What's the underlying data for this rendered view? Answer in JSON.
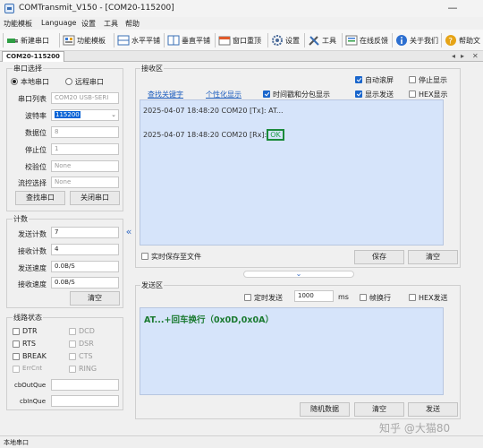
{
  "window": {
    "title": "COMTransmit_V150 - [COM20-115200]",
    "minimize_glyph": "—"
  },
  "menu": [
    "功能模板",
    "Language",
    "设置",
    "工具",
    "帮助"
  ],
  "toolbar": [
    "新建串口",
    "功能模板",
    "水平平铺",
    "垂直平铺",
    "窗口重顶",
    "设置",
    "工具",
    "在线反馈",
    "关于我们",
    "帮助文"
  ],
  "tab": {
    "label": "COM20-115200",
    "left_arrow": "◂",
    "right_arrow": "▸",
    "close": "✕"
  },
  "port": {
    "group_label": "串口选择",
    "local_label": "本地串口",
    "remote_label": "远程串口",
    "rows": [
      {
        "label": "串口列表",
        "value": "COM20  USB-SERI"
      },
      {
        "label": "波特率",
        "value": "115200"
      },
      {
        "label": "数据位",
        "value": "8"
      },
      {
        "label": "停止位",
        "value": "1"
      },
      {
        "label": "校验位",
        "value": "None"
      },
      {
        "label": "流控选择",
        "value": "None"
      }
    ],
    "find_button": "查找串口",
    "close_button": "关闭串口"
  },
  "count": {
    "group_label": "计数",
    "rows": [
      {
        "label": "发送计数",
        "value": "7"
      },
      {
        "label": "接收计数",
        "value": "4"
      },
      {
        "label": "发送速度",
        "value": "0.0B/S"
      },
      {
        "label": "接收速度",
        "value": "0.0B/S"
      }
    ],
    "clear_button": "清空"
  },
  "line": {
    "group_label": "线路状态",
    "checks": [
      {
        "left": "DTR",
        "right": "DCD"
      },
      {
        "left": "RTS",
        "right": "DSR"
      },
      {
        "left": "BREAK",
        "right": "CTS"
      },
      {
        "left": "ErrCnt",
        "right": "RING"
      }
    ],
    "cb_out_label": "cbOutQue",
    "cb_in_label": "cbInQue"
  },
  "receive": {
    "group_label": "接收区",
    "find_keyword": "查找关键字",
    "personalize": "个性化显示",
    "timestamp_label": "时间戳和分包显示",
    "auto_scroll": "自动滚屏",
    "stop_display": "停止显示",
    "show_send": "显示发送",
    "hex_display": "HEX显示",
    "line1": "2025-04-07 18:48:20 COM20 [Tx]: AT...",
    "line2_prefix": "2025-04-07 18:48:20 COM20 [Rx]:",
    "line2_ok": "OK",
    "save_realtime": "实时保存至文件",
    "save_button": "保存",
    "clear_button": "清空"
  },
  "send": {
    "group_label": "发送区",
    "timed_send": "定时发送",
    "interval": "1000",
    "unit": "ms",
    "frame_newline": "帧换行",
    "hex_send": "HEX发送",
    "content": "AT...+回车换行（0x0D,0x0A）",
    "random_button": "随机数据",
    "clear_button": "清空",
    "send_button": "发送"
  },
  "status": {
    "text": "本地串口"
  },
  "watermark": "知乎 @大猫80",
  "handles": {
    "left": "«",
    "down": "⌄"
  },
  "colors": {
    "accent": "#1a66cc",
    "ok_border": "#1b8a3b",
    "ok_text": "#22a04a",
    "receive_bg": "#d6e4fa",
    "send_text": "#1a7a30"
  }
}
